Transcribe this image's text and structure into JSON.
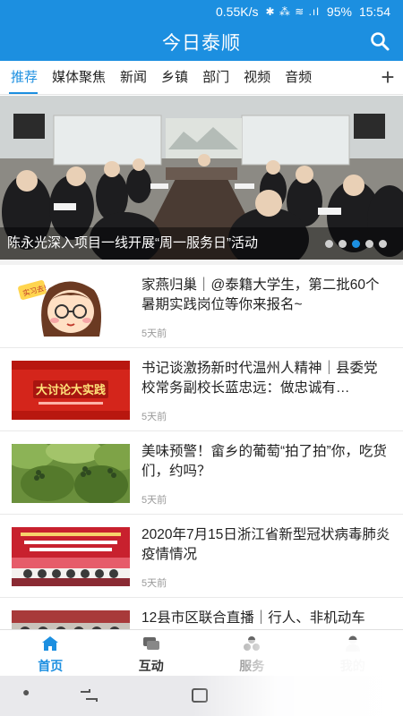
{
  "status_bar": {
    "speed": "0.55K/s",
    "icons": "✱ ⁂ ≋ .ıl",
    "battery": "95%",
    "time": "15:54"
  },
  "header": {
    "title": "今日泰顺",
    "search_icon": "search-icon"
  },
  "tabs": [
    "推荐",
    "媒体聚焦",
    "新闻",
    "乡镇",
    "部门",
    "视频",
    "音频"
  ],
  "active_tab": "推荐",
  "add_tab_icon": "+",
  "banner": {
    "caption": "陈永光深入项目一线开展“周一服务日”活动",
    "dot_count": 5,
    "active_dot": 2
  },
  "news": [
    {
      "title": " 家燕归巢｜@泰籍大学生，第二批60个暑期实践岗位等你来报名~",
      "time": "5天前",
      "thumb": "cartoon-girl"
    },
    {
      "title": "书记谈激扬新时代温州人精神｜县委党校常务副校长蓝忠远：做忠诚有…",
      "time": "5天前",
      "thumb": "red-banner",
      "thumb_text": "大讨论大实践"
    },
    {
      "title": "美味预警！畲乡的葡萄“拍了拍”你，吃货们，约吗？",
      "time": "5天前",
      "thumb": "grape-vines"
    },
    {
      "title": " 2020年7月15日浙江省新型冠状病毒肺炎疫情情况",
      "time": "5天前",
      "thumb": "stage-banner"
    },
    {
      "title": "12县市区联合直播｜行人、非机动车",
      "time": "",
      "thumb": "group-photo"
    }
  ],
  "bottom_nav": [
    {
      "label": "首页",
      "icon": "home-icon",
      "active": true
    },
    {
      "label": "互动",
      "icon": "chat-icon",
      "active": false
    },
    {
      "label": "服务",
      "icon": "services-icon",
      "active": false
    },
    {
      "label": "我的",
      "icon": "user-icon",
      "active": false
    }
  ],
  "colors": {
    "brand": "#1c8fe0",
    "text": "#222222",
    "muted": "#999999"
  }
}
